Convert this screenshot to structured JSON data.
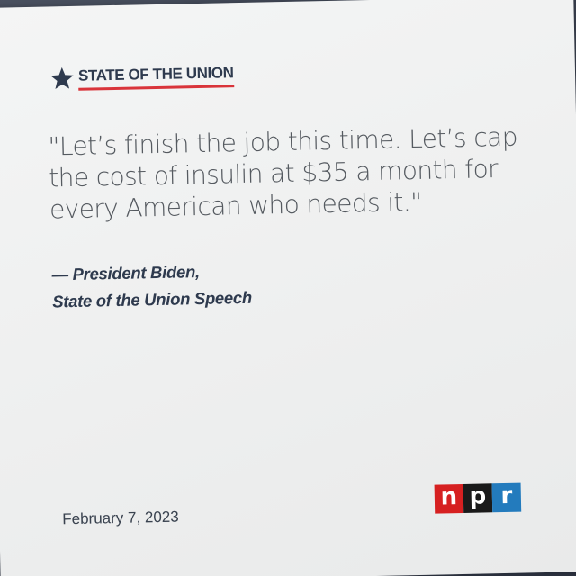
{
  "header": {
    "title": "STATE OF THE UNION",
    "icon": "star-icon"
  },
  "quote": {
    "text": "\"Let’s finish the job this time. Let’s cap the cost of insulin at $35 a month for every American who needs it.\""
  },
  "attribution": {
    "line1": "— President Biden,",
    "line2": "State of the Union Speech"
  },
  "date": "February 7, 2023",
  "logo": {
    "letters": [
      "n",
      "p",
      "r"
    ],
    "colors": [
      "#d62021",
      "#1a1a1a",
      "#237bbd"
    ]
  },
  "colors": {
    "accent_red": "#d9343a",
    "navy": "#2e3a4e",
    "quote_gray": "#555a60"
  }
}
